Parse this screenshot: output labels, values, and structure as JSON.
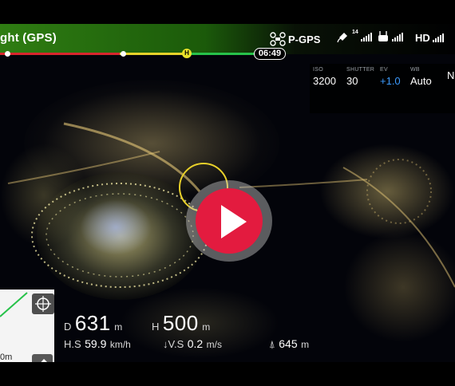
{
  "flight_mode": "ght (GPS)",
  "status": {
    "positioning": "P-GPS",
    "satellites": "14",
    "video_link": "HD"
  },
  "flight_time": "06:49",
  "camera": {
    "iso_label": "ISO",
    "iso": "3200",
    "shutter_label": "SHUTTER",
    "shutter": "30",
    "ev_label": "EV",
    "ev": "+1.0",
    "wb_label": "WB",
    "wb": "Auto",
    "extra_label": "",
    "extra_value": "N"
  },
  "telemetry": {
    "distance_label": "D",
    "distance": "631",
    "distance_unit": "m",
    "height_label": "H",
    "height": "500",
    "height_unit": "m",
    "hspeed_label": "H.S",
    "hspeed": "59.9",
    "hspeed_unit": "km/h",
    "vspeed_label": "V.S",
    "vspeed": "0.2",
    "vspeed_unit": "m/s",
    "altitude": "645",
    "altitude_unit": "m"
  },
  "minimap": {
    "scale": "0m"
  },
  "icons": {
    "drone": "drone-icon",
    "satellite": "satellite-icon",
    "controller": "remote-controller-icon",
    "home": "home-point-icon",
    "play": "play-icon",
    "recenter": "crosshair-icon",
    "eraser": "eraser-icon"
  },
  "colors": {
    "topbar": "#2f7d12",
    "battery_red": "#d8262d",
    "battery_yellow": "#e6d22a",
    "battery_green": "#27c24a",
    "ev_blue": "#3c9bff",
    "play_red": "#e31b3f"
  }
}
